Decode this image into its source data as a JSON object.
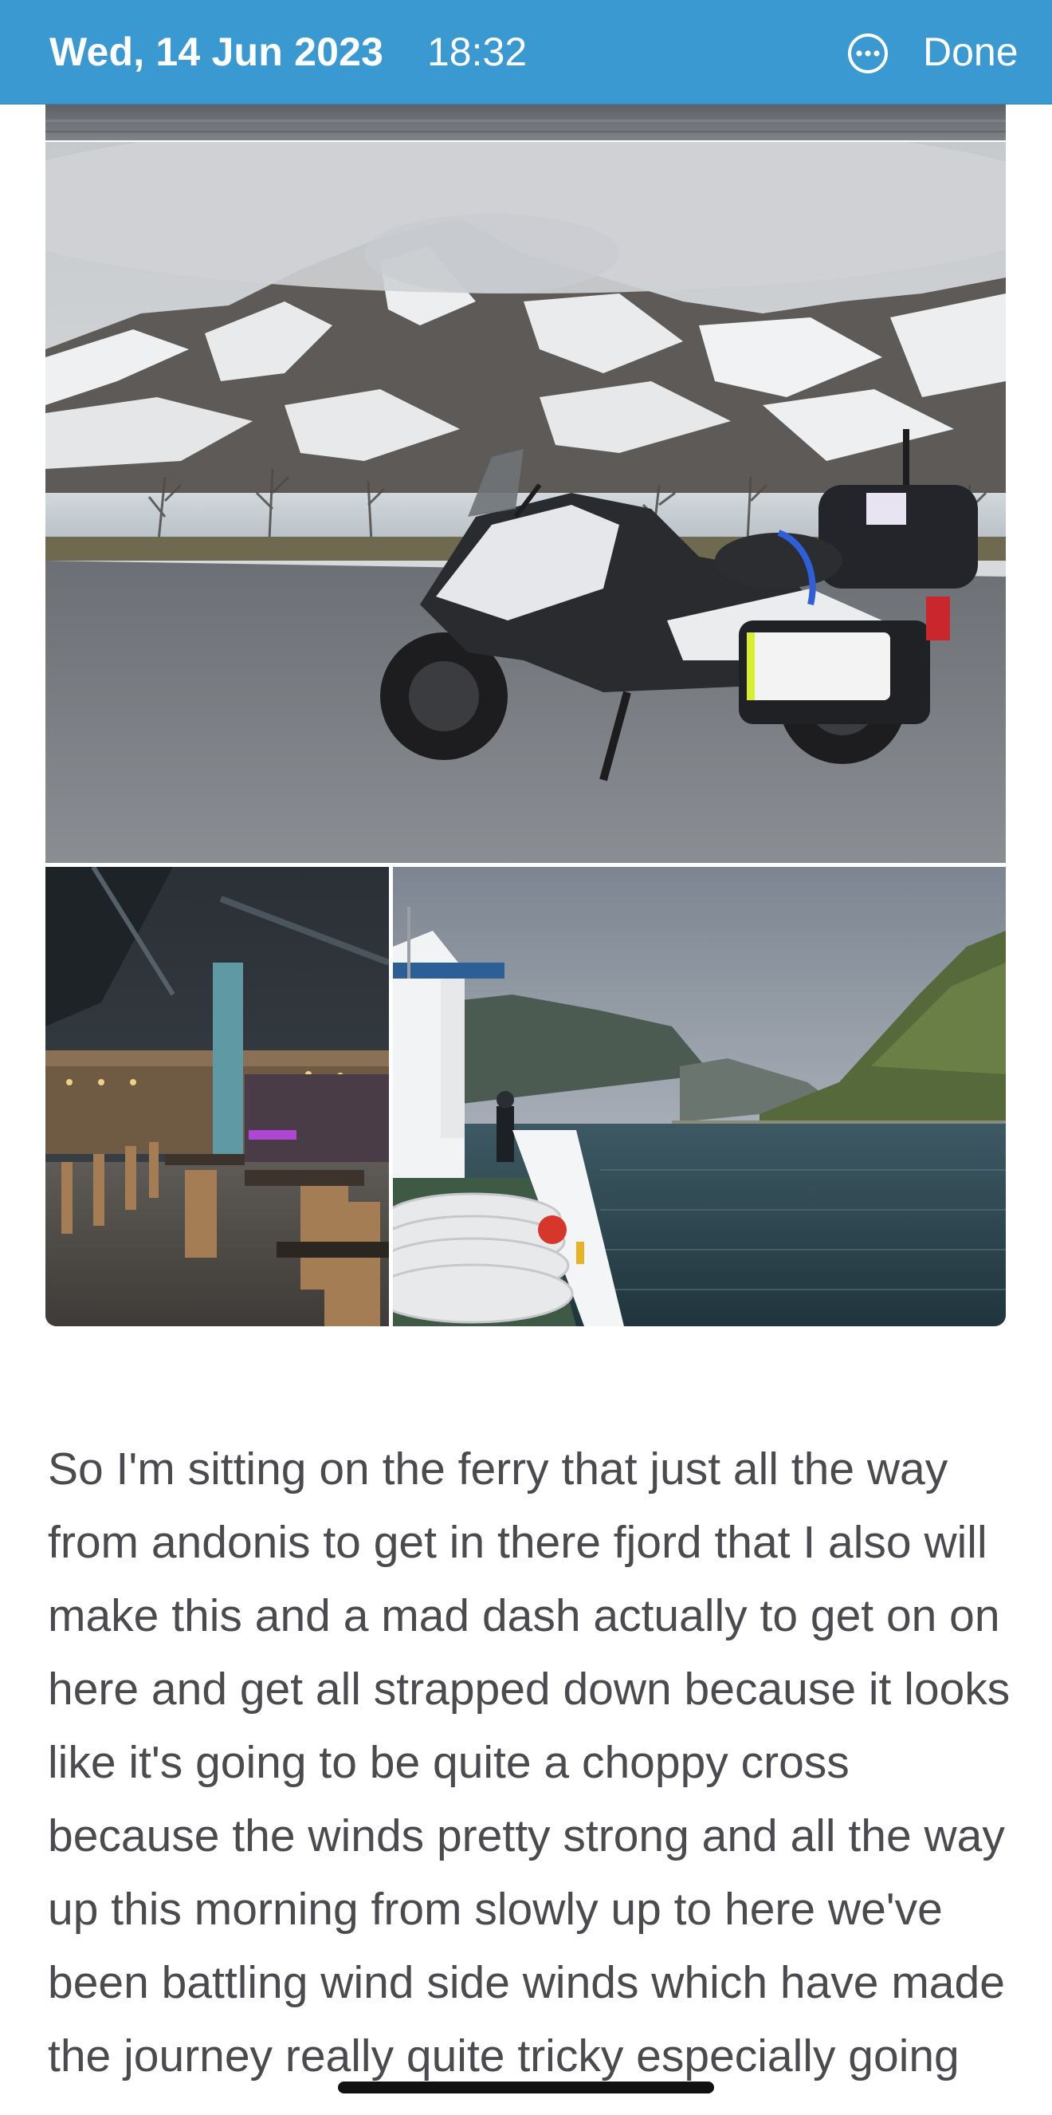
{
  "header": {
    "date": "Wed, 14 Jun 2023",
    "time": "18:32",
    "more_icon": "ellipsis-circle-icon",
    "done_label": "Done",
    "background_color": "#3a99d1",
    "text_color": "#ffffff"
  },
  "photos": [
    {
      "name": "partial-photo-top",
      "subject": "road strip"
    },
    {
      "name": "motorcycle-photo",
      "subject": "motorcycle by snowy mountains"
    },
    {
      "name": "restaurant-photo",
      "subject": "restaurant interior"
    },
    {
      "name": "ferry-photo",
      "subject": "ferry deck on fjord"
    }
  ],
  "entry": {
    "text": "So I'm sitting on the ferry that just all the way from andonis to get in there fjord that I also will make this and a mad dash actually to get on on here and get all strapped down because it looks like it's going to be quite a choppy cross because the winds pretty strong and all the way up this morning from slowly up to here we've been battling wind side winds which have made the journey really quite tricky especially going over some",
    "text_color": "#4a4a4f"
  }
}
